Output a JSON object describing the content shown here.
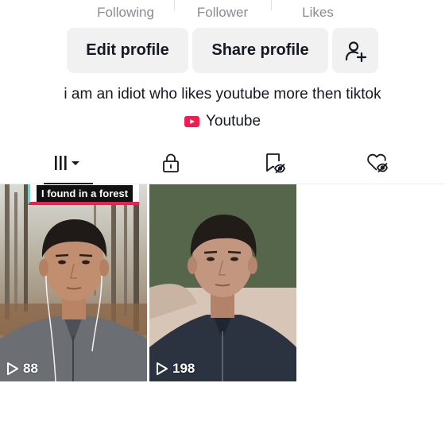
{
  "stats": {
    "following_label": "Following",
    "follower_label": "Follower",
    "likes_label": "Likes"
  },
  "buttons": {
    "edit_profile": "Edit profile",
    "share_profile": "Share profile",
    "add_friend_icon": "add-person-icon"
  },
  "bio": "i am an idiot who likes youtube more then tiktok",
  "link": {
    "icon": "youtube-icon",
    "label": "Youtube",
    "color": "#ee1d52"
  },
  "tabs": [
    {
      "icon": "grid-videos-icon",
      "active": true
    },
    {
      "icon": "lock-icon",
      "active": false
    },
    {
      "icon": "saved-icon",
      "active": false
    },
    {
      "icon": "liked-icon",
      "active": false
    }
  ],
  "videos": [
    {
      "caption": "I found in a forest",
      "plays": "88"
    },
    {
      "caption": "",
      "plays": "198"
    }
  ],
  "colors": {
    "accent_red": "#ee1d52",
    "accent_cyan": "#25f4ee",
    "button_bg": "#f1f1f2",
    "muted_text": "#8a8b91"
  }
}
